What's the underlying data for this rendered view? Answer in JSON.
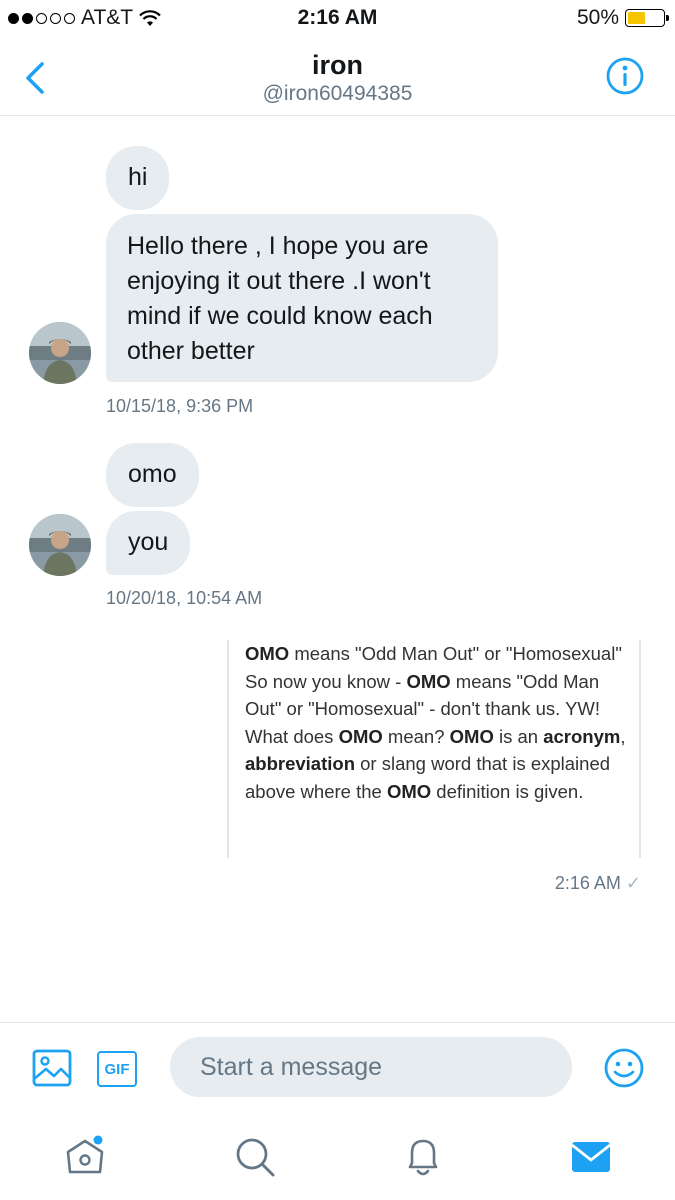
{
  "status_bar": {
    "carrier": "AT&T",
    "time": "2:16 AM",
    "battery": "50%",
    "battery_level": 0.5,
    "signal_bars_filled": 2,
    "signal_bars_total": 5
  },
  "header": {
    "title": "iron",
    "handle": "@iron60494385"
  },
  "messages": {
    "group1": {
      "msg1": "hi",
      "msg2": "Hello there , I hope you are enjoying it out there .I won't mind if we could know each other better",
      "timestamp": "10/15/18, 9:36 PM"
    },
    "group2": {
      "msg1": "omo",
      "msg2": "you",
      "timestamp": "10/20/18, 10:54 AM"
    },
    "sent": {
      "timestamp": "2:16 AM",
      "card": [
        {
          "t": "OMO",
          "b": true
        },
        {
          "t": " means \"Odd Man Out\" or \"Homosexual\" So now you know - ",
          "b": false
        },
        {
          "t": "OMO",
          "b": true
        },
        {
          "t": " means \"Odd Man Out\" or \"Homosexual\" - don't thank us. YW! What does ",
          "b": false
        },
        {
          "t": "OMO",
          "b": true
        },
        {
          "t": " mean? ",
          "b": false
        },
        {
          "t": "OMO",
          "b": true
        },
        {
          "t": " is an ",
          "b": false
        },
        {
          "t": "acronym",
          "b": true
        },
        {
          "t": ", ",
          "b": false
        },
        {
          "t": "abbreviation",
          "b": true
        },
        {
          "t": " or slang word that is explained above where the ",
          "b": false
        },
        {
          "t": "OMO",
          "b": true
        },
        {
          "t": " definition is given.",
          "b": false
        }
      ]
    }
  },
  "composer": {
    "placeholder": "Start a message",
    "gif_label": "GIF"
  },
  "colors": {
    "accent": "#1da1f2",
    "bubble_gray": "#e6ecf0",
    "secondary_text": "#657786",
    "battery_fill": "#f5c500"
  },
  "icons": {
    "back": "chevron-left-icon",
    "info": "info-icon",
    "image": "image-icon",
    "gif": "gif-icon",
    "emoji": "emoji-icon",
    "home": "home-icon",
    "search": "search-icon",
    "notifications": "bell-icon",
    "messages": "mail-icon"
  }
}
